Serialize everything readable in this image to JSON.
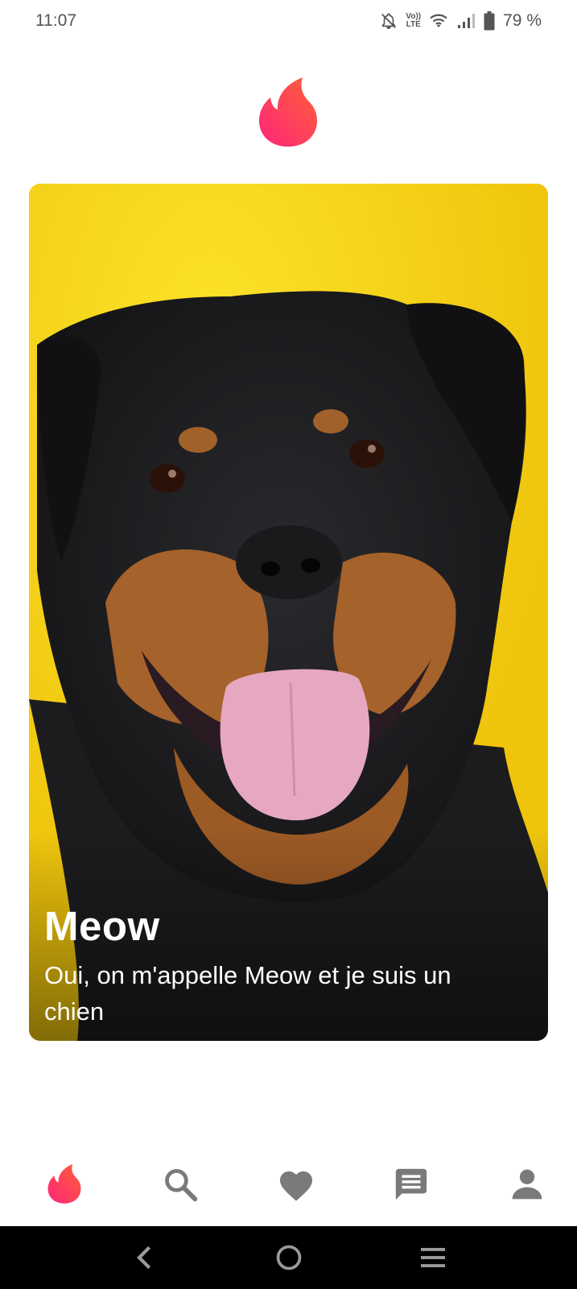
{
  "status_bar": {
    "time": "11:07",
    "volte_top": "Vo))",
    "volte_bottom": "LTE",
    "battery": "79 %",
    "icons": [
      "mute-bell-icon",
      "volte-icon",
      "wifi-icon",
      "signal-icon",
      "battery-icon"
    ]
  },
  "app": {
    "logo_icon": "flame-logo-icon",
    "accent_gradient": [
      "#fd267a",
      "#ff6036"
    ]
  },
  "card": {
    "name": "Meow",
    "bio": "Oui, on m'appelle Meow et je suis un chien",
    "photo": "rottweiler-photo"
  },
  "bottom_nav": {
    "items": [
      {
        "icon": "flame-icon",
        "active": true
      },
      {
        "icon": "search-icon",
        "active": false
      },
      {
        "icon": "heart-icon",
        "active": false
      },
      {
        "icon": "chat-icon",
        "active": false
      },
      {
        "icon": "profile-icon",
        "active": false
      }
    ],
    "inactive_color": "#7a7a7a"
  },
  "system_nav": {
    "buttons": [
      "back-icon",
      "home-icon",
      "recents-icon"
    ]
  }
}
